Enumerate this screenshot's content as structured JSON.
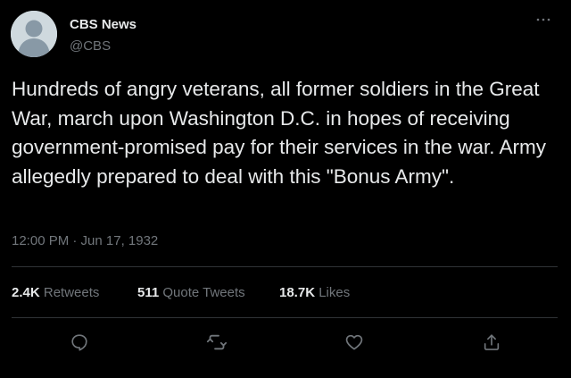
{
  "tweet": {
    "author": {
      "display_name": "CBS News",
      "handle": "@CBS"
    },
    "text": "Hundreds of angry veterans, all former soldiers in the Great War, march upon Washington D.C. in hopes of receiving government-promised pay for their services in the war. Army allegedly prepared to deal with this \"Bonus Army\".",
    "timestamp": "12:00 PM · Jun 17, 1932",
    "stats": {
      "retweets_count": "2.4K",
      "retweets_label": "Retweets",
      "quote_tweets_count": "511",
      "quote_tweets_label": "Quote Tweets",
      "likes_count": "18.7K",
      "likes_label": "Likes"
    },
    "actions": {
      "reply_icon": "reply-icon",
      "retweet_icon": "retweet-icon",
      "like_icon": "like-icon",
      "share_icon": "share-icon"
    }
  },
  "colors": {
    "background": "#000000",
    "text_primary": "#e7e9ea",
    "text_secondary": "#71767b",
    "divider": "#2f3336",
    "avatar_background": "#cfd9de",
    "avatar_silhouette": "#657786"
  }
}
